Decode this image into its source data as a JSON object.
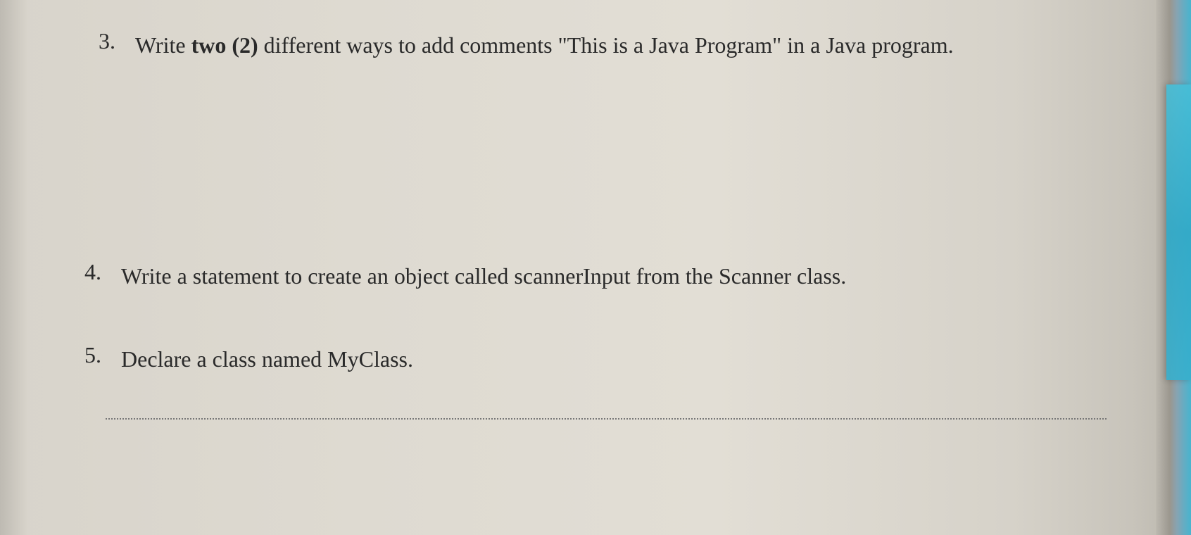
{
  "questions": [
    {
      "number": "3.",
      "prefix": "Write ",
      "bold": "two (2)",
      "suffix": " different ways to add comments \"This is a Java Program\" in a Java program."
    },
    {
      "number": "4.",
      "prefix": "Write a statement to create an object called scannerInput from the Scanner class.",
      "bold": "",
      "suffix": ""
    },
    {
      "number": "5.",
      "prefix": "Declare a class named MyClass.",
      "bold": "",
      "suffix": ""
    }
  ]
}
